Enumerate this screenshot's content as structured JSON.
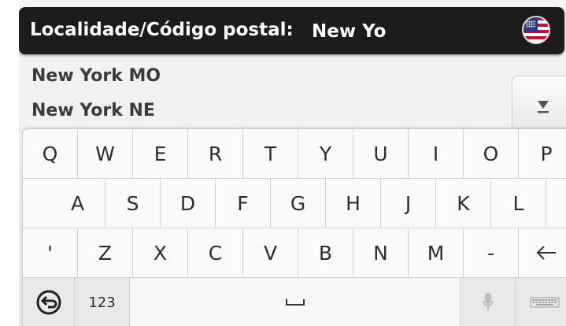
{
  "search": {
    "label": "Localidade/Código postal:",
    "value": "New Yo",
    "country_flag_icon": "us-flag-icon"
  },
  "results": [
    {
      "label": "New York MO"
    },
    {
      "label": "New York NE"
    }
  ],
  "scroll": {
    "icon": "scroll-down-icon"
  },
  "keyboard": {
    "row1": [
      "Q",
      "W",
      "E",
      "R",
      "T",
      "Y",
      "U",
      "I",
      "O",
      "P"
    ],
    "row2": [
      "A",
      "S",
      "D",
      "F",
      "G",
      "H",
      "J",
      "K",
      "L"
    ],
    "row3": [
      "'",
      "Z",
      "X",
      "C",
      "V",
      "B",
      "N",
      "M",
      "-"
    ],
    "backspace_icon": "backspace-arrow-icon",
    "back_icon": "back-circle-icon",
    "numbers_label": "123",
    "space_icon": "space-bar-icon",
    "mic_icon": "microphone-icon",
    "layout_icon": "keyboard-layout-icon"
  },
  "colors": {
    "bar_background": "#1c1c1c",
    "text_dark": "#3a3a3a",
    "key_border": "#d0d0d0"
  }
}
